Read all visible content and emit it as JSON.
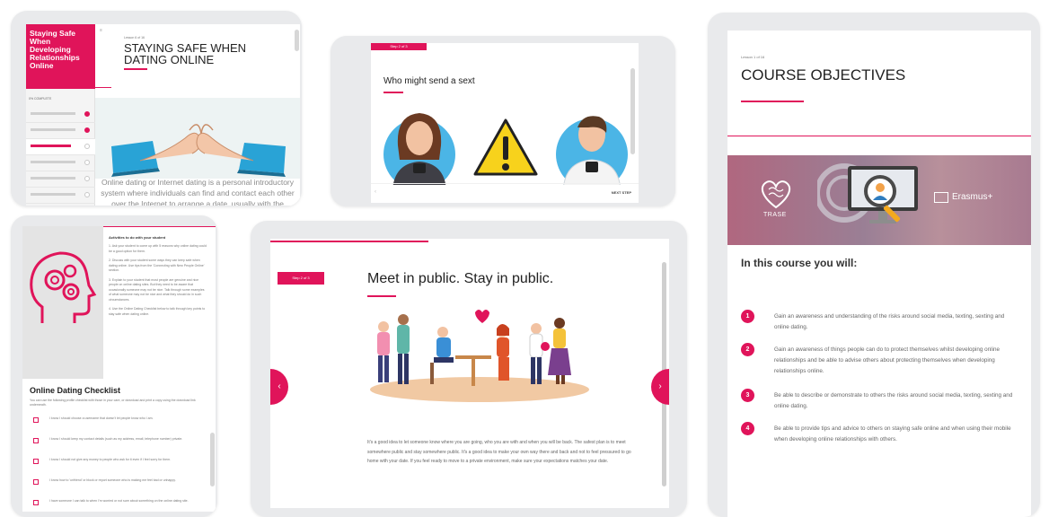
{
  "panel1": {
    "brand": "Staying Safe When Developing Relationships Online",
    "status": "0% COMPLETE",
    "lesson_label": "Lesson 6 of 16",
    "title": "STAYING SAFE WHEN DATING ONLINE",
    "body": "Online dating or Internet dating is a personal introductory system where individuals can find and contact each other over the Internet to arrange a date, usually with the"
  },
  "panel2": {
    "step": "Step 2 of 3",
    "title": "Who might send a sext",
    "next": "NEXT STEP"
  },
  "panel3": {
    "activities_title": "Activities to do with your student",
    "activities": [
      "1. Ask your student to come up with 5 reasons why online dating could be a good option for them.",
      "2. Discuss with your student some ways they can keep safe when dating online. Use tips from the 'Connecting with New People Online' section.",
      "3. Explain to your student that most people are genuine and nice people on online dating sites. But they need to be aware that occasionally someone may not be nice. Talk through some examples of what someone may not be nice and what they should do in such circumstances.",
      "4. Use the Online Dating Checklist below to talk through key points to stay safe when dating online."
    ],
    "checklist_title": "Online Dating Checklist",
    "checklist_intro": "You can use the following profile checklist with those in your care, or download and print a copy using the download link underneath.",
    "checklist": [
      "I know I should choose a username that doesn't let people know who I am.",
      "I know I should keep my contact details (such as my address, email, telephone number) private.",
      "I know I should not give any money to people who ask for it even if I feel sorry for them.",
      "I know how to 'unfriend' or block or report someone who is making me feel bad or unhappy.",
      "I have someone I can talk to when I'm worried or not sure about something on the online dating site."
    ]
  },
  "panel4": {
    "step": "Step 2 of 3",
    "title": "Meet in public. Stay in public.",
    "body": "It's a good idea to let someone know where you are going, who you are with and when you will be back. The safest plan is to meet somewhere public and stay somewhere public. It's a good idea to make your own way there and back and not to feel pressured to go home with your date. If you feel ready to move to a private environment, make sure your expectations matches your date.",
    "prev_glyph": "‹",
    "next_glyph": "›"
  },
  "panel5": {
    "lesson_label": "Lesson 1 of 16",
    "title": "COURSE OBJECTIVES",
    "banner_left": "TRASE",
    "banner_right": "Erasmus+",
    "heading": "In this course you will:",
    "objectives": [
      {
        "num": "1",
        "text": "Gain an awareness and understanding of the risks around social media, texting, sexting and online dating."
      },
      {
        "num": "2",
        "text": "Gain an awareness of things people can do to protect themselves whilst developing online relationships and be able to advise others about protecting themselves when developing relationships online."
      },
      {
        "num": "3",
        "text": "Be able to  describe or demonstrate to others the risks around social media, texting, sexting and online dating."
      },
      {
        "num": "4",
        "text": "Be able to provide tips and advice to others on staying safe online and when using their mobile when developing online relationships with others."
      }
    ]
  },
  "colors": {
    "accent": "#e0145a",
    "device": "#e9eaec"
  }
}
